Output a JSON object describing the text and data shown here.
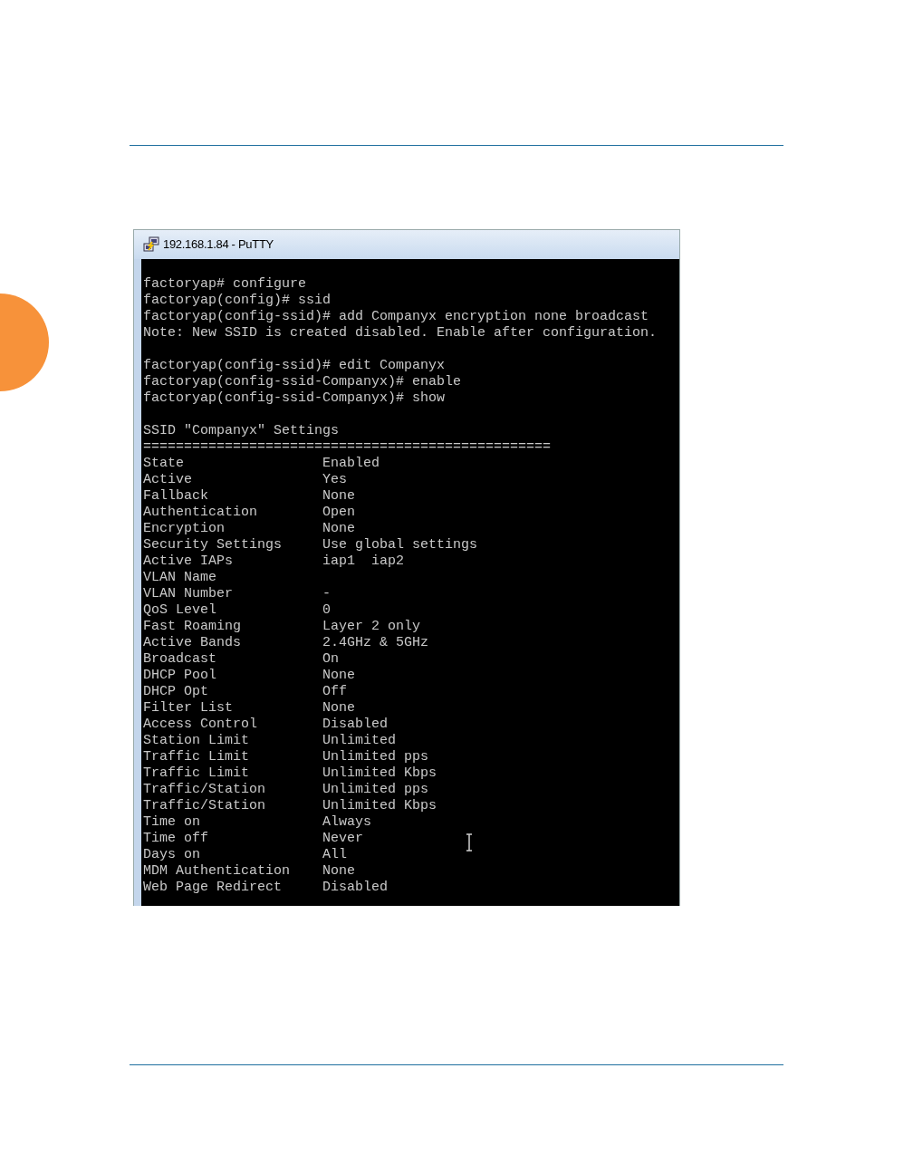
{
  "window": {
    "title": "192.168.1.84 - PuTTY"
  },
  "terminal": {
    "lines": [
      {
        "kind": "text",
        "text": "factoryap# configure"
      },
      {
        "kind": "text",
        "text": "factoryap(config)# ssid"
      },
      {
        "kind": "text",
        "text": "factoryap(config-ssid)# add Companyx encryption none broadcast"
      },
      {
        "kind": "text",
        "text": "Note: New SSID is created disabled. Enable after configuration."
      },
      {
        "kind": "blank"
      },
      {
        "kind": "text",
        "text": "factoryap(config-ssid)# edit Companyx"
      },
      {
        "kind": "text",
        "text": "factoryap(config-ssid-Companyx)# enable"
      },
      {
        "kind": "text",
        "text": "factoryap(config-ssid-Companyx)# show"
      },
      {
        "kind": "blank"
      },
      {
        "kind": "text",
        "text": "SSID \"Companyx\" Settings"
      },
      {
        "kind": "rule",
        "text": "=================================================="
      },
      {
        "kind": "setting",
        "label": "State",
        "value": "Enabled"
      },
      {
        "kind": "setting",
        "label": "Active",
        "value": "Yes"
      },
      {
        "kind": "setting",
        "label": "Fallback",
        "value": "None"
      },
      {
        "kind": "setting",
        "label": "Authentication",
        "value": "Open"
      },
      {
        "kind": "setting",
        "label": "Encryption",
        "value": "None"
      },
      {
        "kind": "setting",
        "label": "Security Settings",
        "value": "Use global settings"
      },
      {
        "kind": "setting",
        "label": "Active IAPs",
        "value": "iap1  iap2"
      },
      {
        "kind": "setting",
        "label": "VLAN Name"
      },
      {
        "kind": "setting",
        "label": "VLAN Number",
        "value": "-"
      },
      {
        "kind": "setting",
        "label": "QoS Level",
        "value": "0"
      },
      {
        "kind": "setting",
        "label": "Fast Roaming",
        "value": "Layer 2 only"
      },
      {
        "kind": "setting",
        "label": "Active Bands",
        "value": "2.4GHz & 5GHz"
      },
      {
        "kind": "setting",
        "label": "Broadcast",
        "value": "On"
      },
      {
        "kind": "setting",
        "label": "DHCP Pool",
        "value": "None"
      },
      {
        "kind": "setting",
        "label": "DHCP Opt",
        "value": "Off"
      },
      {
        "kind": "setting",
        "label": "Filter List",
        "value": "None"
      },
      {
        "kind": "setting",
        "label": "Access Control",
        "value": "Disabled"
      },
      {
        "kind": "setting",
        "label": "Station Limit",
        "value": "Unlimited"
      },
      {
        "kind": "setting",
        "label": "Traffic Limit",
        "value": "Unlimited pps"
      },
      {
        "kind": "setting",
        "label": "Traffic Limit",
        "value": "Unlimited Kbps"
      },
      {
        "kind": "setting",
        "label": "Traffic/Station",
        "value": "Unlimited pps"
      },
      {
        "kind": "setting",
        "label": "Traffic/Station",
        "value": "Unlimited Kbps"
      },
      {
        "kind": "setting",
        "label": "Time on",
        "value": "Always"
      },
      {
        "kind": "setting",
        "label": "Time off",
        "value": "Never"
      },
      {
        "kind": "setting",
        "label": "Days on",
        "value": "All"
      },
      {
        "kind": "setting",
        "label": "MDM Authentication",
        "value": "None"
      },
      {
        "kind": "setting",
        "label": "Web Page Redirect",
        "value": "Disabled"
      }
    ]
  }
}
